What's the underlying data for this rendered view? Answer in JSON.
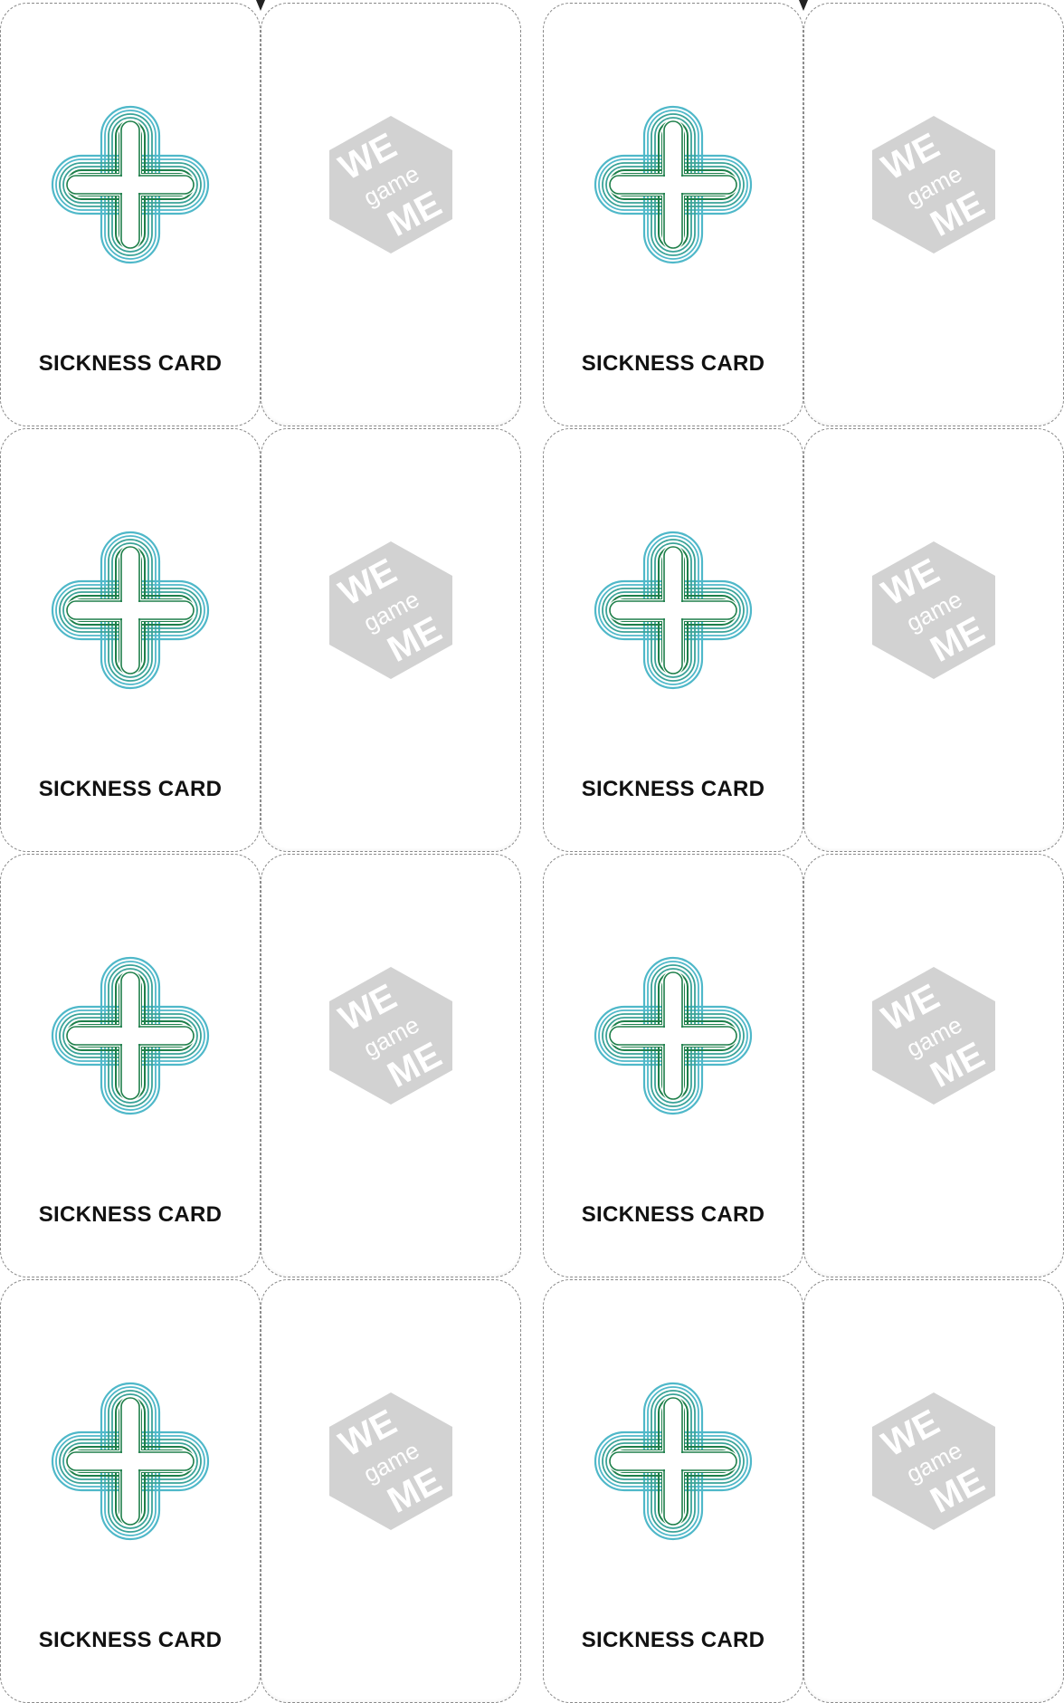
{
  "card_front": {
    "title": "SICKNESS CARD",
    "icon": "cross-icon",
    "colors": {
      "outer": "#4fb8c9",
      "middle": "#3aa398",
      "inner": "#1e7f4a"
    }
  },
  "card_back": {
    "logo": "we-game-me-logo",
    "logo_text": [
      "WE",
      "game",
      "ME"
    ],
    "logo_color": "#d2d2d2"
  },
  "layout_meta": {
    "card_pairs": 8,
    "columns": 2,
    "rows": 4
  }
}
